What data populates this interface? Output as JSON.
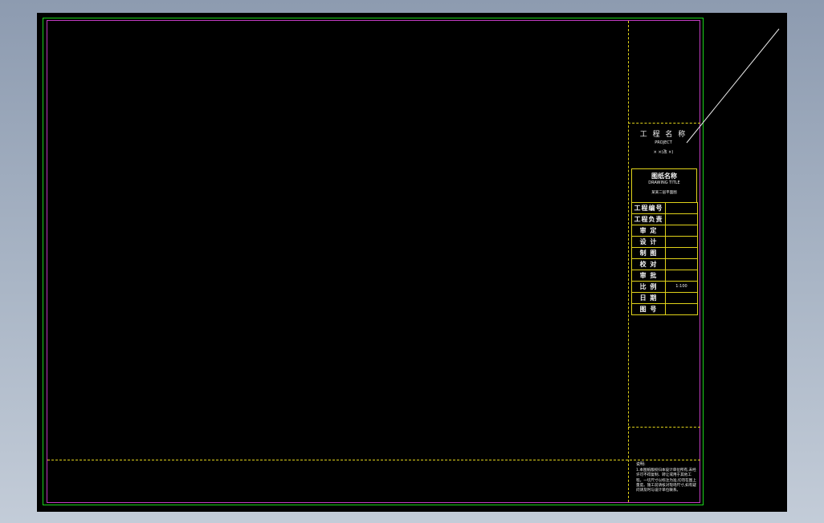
{
  "title_block": {
    "project_title": "工 程 名 称",
    "project_subtitle": "PROJECT",
    "project_note": "× ×(改 ×)",
    "drawing_title": "图纸名称",
    "drawing_subtitle": "DRAWING TITLE",
    "drawing_name": "某某二层平面图",
    "rows": [
      {
        "label": "工程编号",
        "value": ""
      },
      {
        "label": "工程负责",
        "value": ""
      },
      {
        "label": "审 定",
        "value": ""
      },
      {
        "label": "设 计",
        "value": ""
      },
      {
        "label": "制 图",
        "value": ""
      },
      {
        "label": "校 对",
        "value": ""
      },
      {
        "label": "审 批",
        "value": ""
      },
      {
        "label": "比 例",
        "value": "1:100"
      },
      {
        "label": "日 期",
        "value": ""
      },
      {
        "label": "图 号",
        "value": ""
      }
    ]
  },
  "notes": {
    "heading": "说明:",
    "body": "1.本图纸版权归本设计单位所有,未经许可不得复制、转让或用于其他工程。一切尺寸以标注为准,切勿在图上量度。施工前请核对现场尺寸,如有疑问请及时与设计单位联系。"
  },
  "colors": {
    "background": "#000000",
    "outer_frame": "#1bd41b",
    "inner_frame": "#c03cc0",
    "title_block_lines": "#e0d21a",
    "text": "#f2f2f2"
  }
}
